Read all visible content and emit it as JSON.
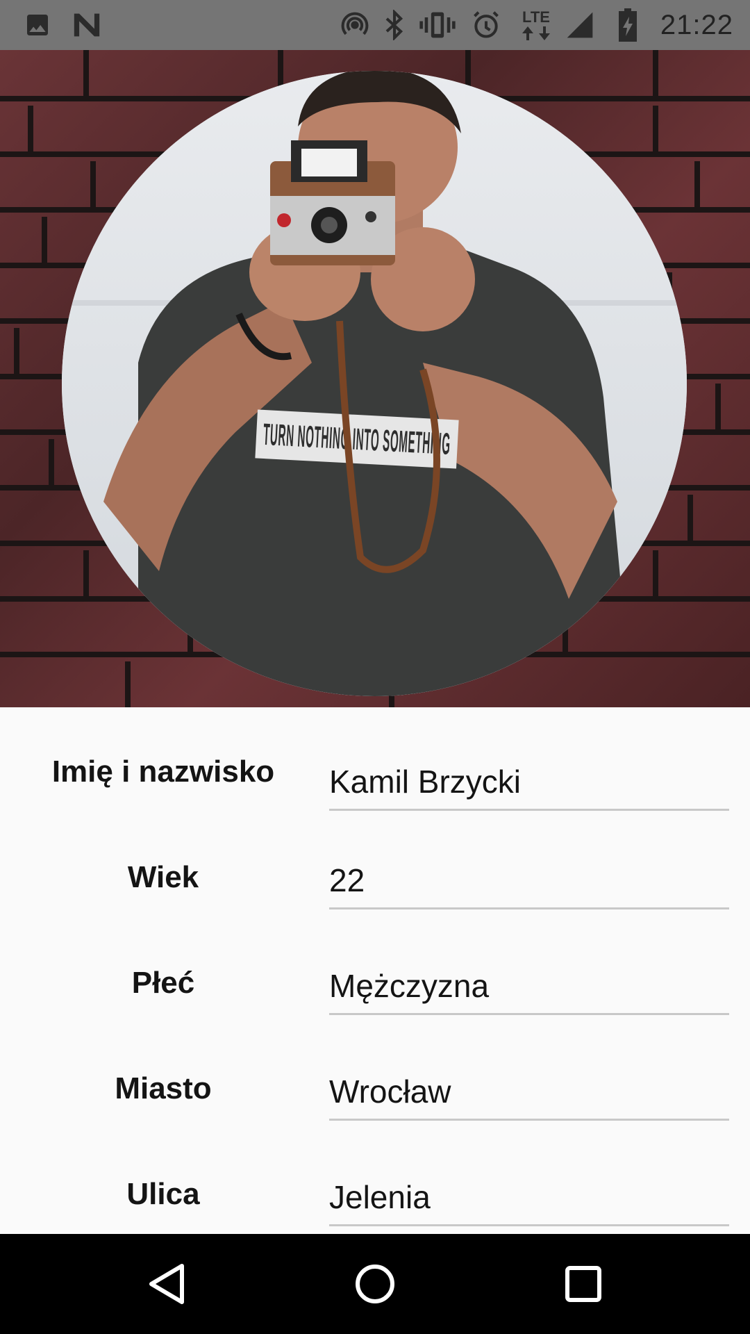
{
  "status_bar": {
    "time": "21:22",
    "network": "LTE",
    "icons": [
      "image-icon",
      "n-icon",
      "hotspot-icon",
      "bluetooth-icon",
      "vibrate-icon",
      "alarm-icon",
      "lte-icon",
      "signal-icon",
      "battery-icon"
    ]
  },
  "profile": {
    "photo": "man-with-instant-camera-photo",
    "shirt_text": "TURN NOTHING INTO SOMETHING"
  },
  "form": {
    "fields": [
      {
        "label": "Imię i nazwisko",
        "value": "Kamil Brzycki"
      },
      {
        "label": "Wiek",
        "value": "22"
      },
      {
        "label": "Płeć",
        "value": "Mężczyzna"
      },
      {
        "label": "Miasto",
        "value": "Wrocław"
      },
      {
        "label": "Ulica",
        "value": "Jelenia"
      }
    ]
  },
  "nav_bar": {
    "icons": [
      "back-icon",
      "home-icon",
      "recents-icon"
    ]
  },
  "colors": {
    "status_bar": "#757575",
    "brick": "#5a2c2e",
    "background": "#fafafa",
    "nav_bar": "#000000"
  }
}
